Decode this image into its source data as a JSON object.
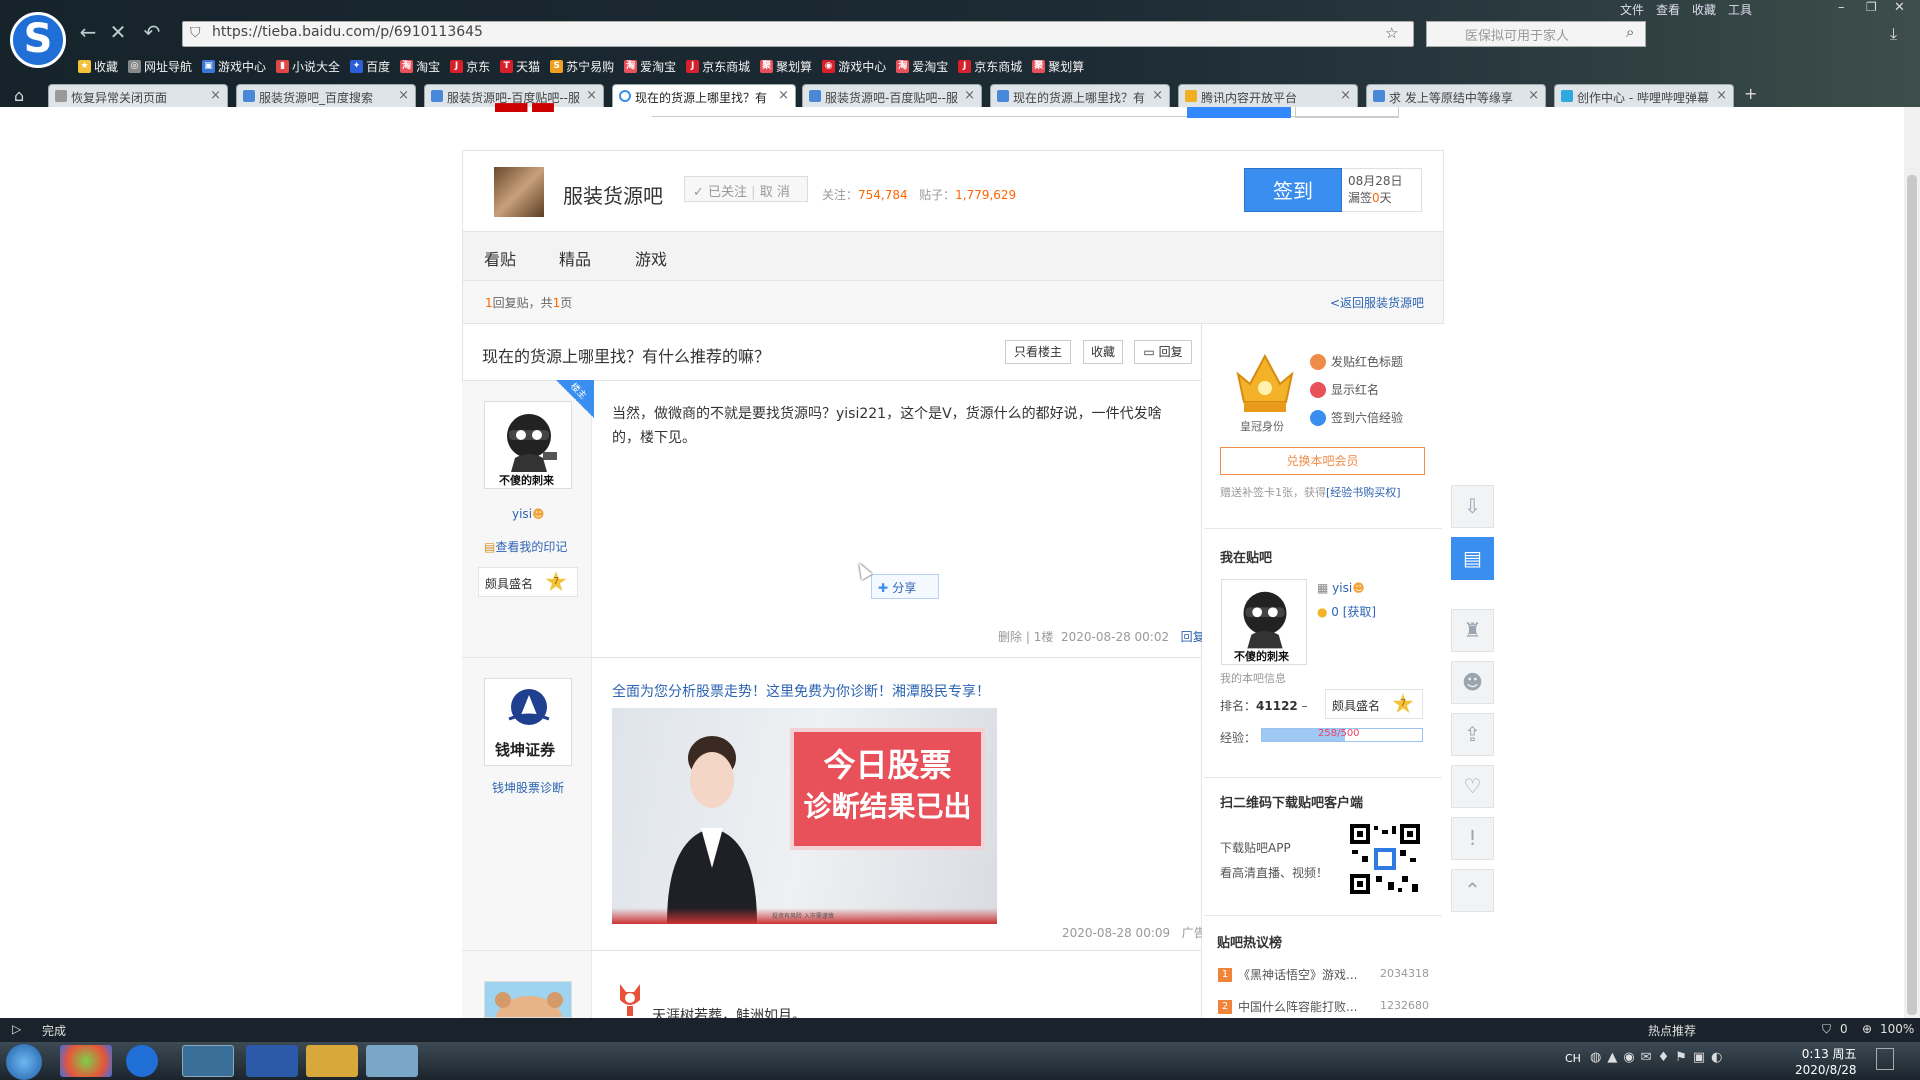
{
  "browser": {
    "url": "https://tieba.baidu.com/p/6910113645",
    "search_placeholder": "医保拟可用于家人",
    "menu": [
      "文件",
      "查看",
      "收藏",
      "工具"
    ],
    "bookmarks": [
      "收藏",
      "网址导航",
      "游戏中心",
      "小说大全",
      "百度",
      "淘宝",
      "京东",
      "天猫",
      "苏宁易购",
      "爱淘宝",
      "京东商城",
      "聚划算",
      "游戏中心",
      "爱淘宝",
      "京东商城",
      "聚划算"
    ],
    "tabs": [
      {
        "label": "恢复异常关闭页面"
      },
      {
        "label": "服装货源吧_百度搜索"
      },
      {
        "label": "服装货源吧-百度贴吧--服"
      },
      {
        "label": "现在的货源上哪里找？有"
      },
      {
        "label": "服装货源吧-百度贴吧--服"
      },
      {
        "label": "现在的货源上哪里找？有"
      },
      {
        "label": "腾讯内容开放平台"
      },
      {
        "label": "求 发上等原结中等缘享"
      },
      {
        "label": "创作中心 - 哔哩哔哩弹幕"
      }
    ],
    "active_tab": 3
  },
  "forum": {
    "name": "服装货源吧",
    "follow_state": "已关注",
    "unfollow": "取 消",
    "follow_label": "关注：",
    "follow_count": "754,784",
    "posts_label": "贴子：",
    "posts_count": "1,779,629",
    "sign_button": "签到",
    "sign_date": "08月28日",
    "sign_missed_prefix": "漏签",
    "sign_missed_days": "0",
    "sign_missed_suffix": "天",
    "tabs": [
      "看贴",
      "精品",
      "游戏"
    ],
    "reply_count": "1",
    "reply_suffix": "回复贴，共",
    "page_count": "1",
    "page_suffix": "页",
    "back_link": "<返回服装货源吧"
  },
  "thread": {
    "title": "现在的货源上哪里找？有什么推荐的嘛？",
    "btn_only_op": "只看楼主",
    "btn_collect": "收藏",
    "btn_reply": "回复",
    "ribbon": "楼主",
    "post1": {
      "avatar_caption": "不傻的刺来",
      "username": "yisi",
      "imprint": "查看我的印记",
      "badge_label": "颇具盛名",
      "badge_level": "7",
      "text": "当然，做微商的不就是要找货源吗？yisi221，这个是V，货源什么的都好说，一件代发啥的，楼下见。",
      "share": "分享",
      "meta_delete": "删除",
      "meta_floor": "1楼",
      "meta_time": "2020-08-28 00:02",
      "meta_reply": "回复"
    },
    "ad": {
      "brand_logo_text": "钱坤证券",
      "user": "钱坤股票诊断",
      "link": "全面为您分析股票走势！这里免费为你诊断！湘潭股民专享！",
      "img_line1": "今日股票",
      "img_line2": "诊断结果已出",
      "img_caption": "投资有风险 入市需谨慎",
      "time": "2020-08-28 00:09",
      "tag": "广告"
    },
    "post3_text": "天涯树若葬，鲑洲如月。"
  },
  "sidebar": {
    "crown_label": "皇冠身份",
    "privileges": [
      "发贴红色标题",
      "显示红名",
      "签到六倍经验"
    ],
    "member_button": "兑换本吧会员",
    "gift_text": "赠送补签卡1张，获得",
    "gift_link": "[经验书购买权]",
    "my_bar_title": "我在贴吧",
    "me_avatar_caption": "不傻的刺来",
    "me_name": "yisi",
    "me_get": "0 [获取]",
    "me_info": "我的本吧信息",
    "rank_label": "排名：",
    "rank_value": "41122",
    "rank_suffix": "–",
    "badge_label": "颇具盛名",
    "badge_level": "7",
    "exp_label": "经验：",
    "exp_text": "258/500",
    "exp_fraction": 0.516,
    "qr_title": "扫二维码下载贴吧客户端",
    "qr_line1": "下载贴吧APP",
    "qr_line2": "看高清直播、视频！",
    "hot_title": "贴吧热议榜",
    "hot_items": [
      {
        "rank": "1",
        "title": "《黑神话悟空》游戏...",
        "value": "2034318",
        "color": "#f0843a"
      },
      {
        "rank": "2",
        "title": "中国什么阵容能打败...",
        "value": "1232680",
        "color": "#f0843a"
      }
    ]
  },
  "status": {
    "left": "完成",
    "hot": "热点推荐",
    "zoom": "100%",
    "count": "0"
  },
  "taskbar": {
    "lang": "CH",
    "time": "0:13 周五",
    "date": "2020/8/28"
  }
}
